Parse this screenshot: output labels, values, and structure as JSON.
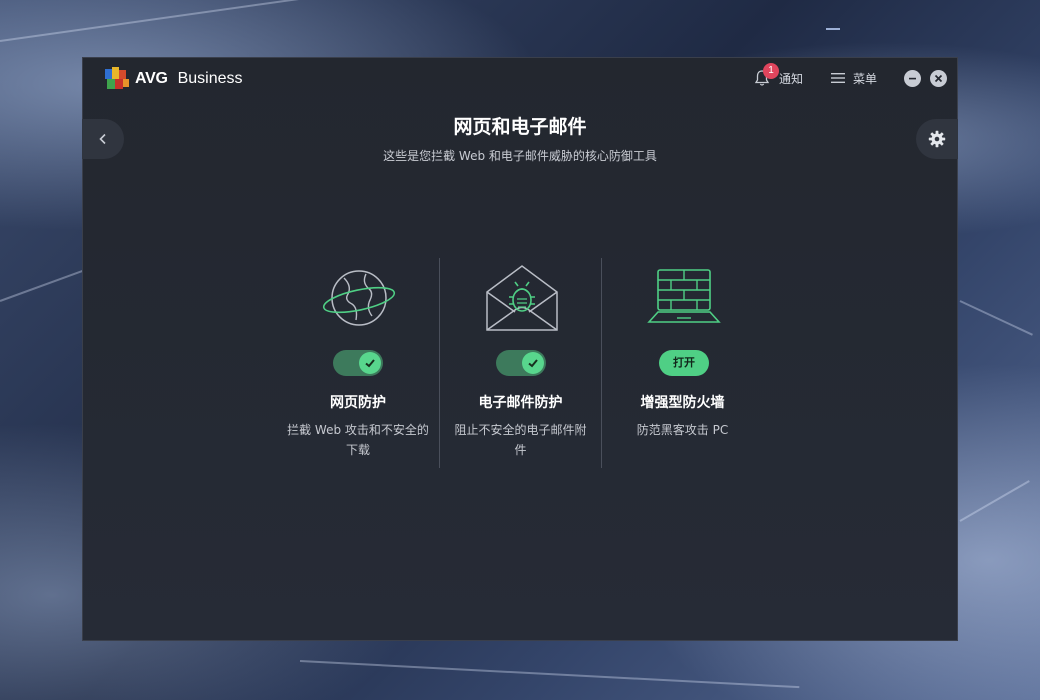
{
  "app": {
    "brand": "AVG",
    "product": "Business"
  },
  "titlebar": {
    "notifications_label": "通知",
    "notifications_count": "1",
    "menu_label": "菜单"
  },
  "page": {
    "title": "网页和电子邮件",
    "subtitle": "这些是您拦截 Web 和电子邮件威胁的核心防御工具"
  },
  "features": [
    {
      "title": "网页防护",
      "description": "拦截 Web 攻击和不安全的下载",
      "state": "on",
      "icon": "globe-icon"
    },
    {
      "title": "电子邮件防护",
      "description": "阻止不安全的电子邮件附件",
      "state": "on",
      "icon": "envelope-bug-icon"
    },
    {
      "title": "增强型防火墙",
      "description": "防范黑客攻击 PC",
      "state": "off",
      "action_label": "打开",
      "icon": "firewall-icon"
    }
  ],
  "colors": {
    "accent_green": "#4fcf85",
    "toggle_track": "#3d7a5c",
    "badge_red": "#e0455d",
    "window_bg": "#23272f"
  }
}
